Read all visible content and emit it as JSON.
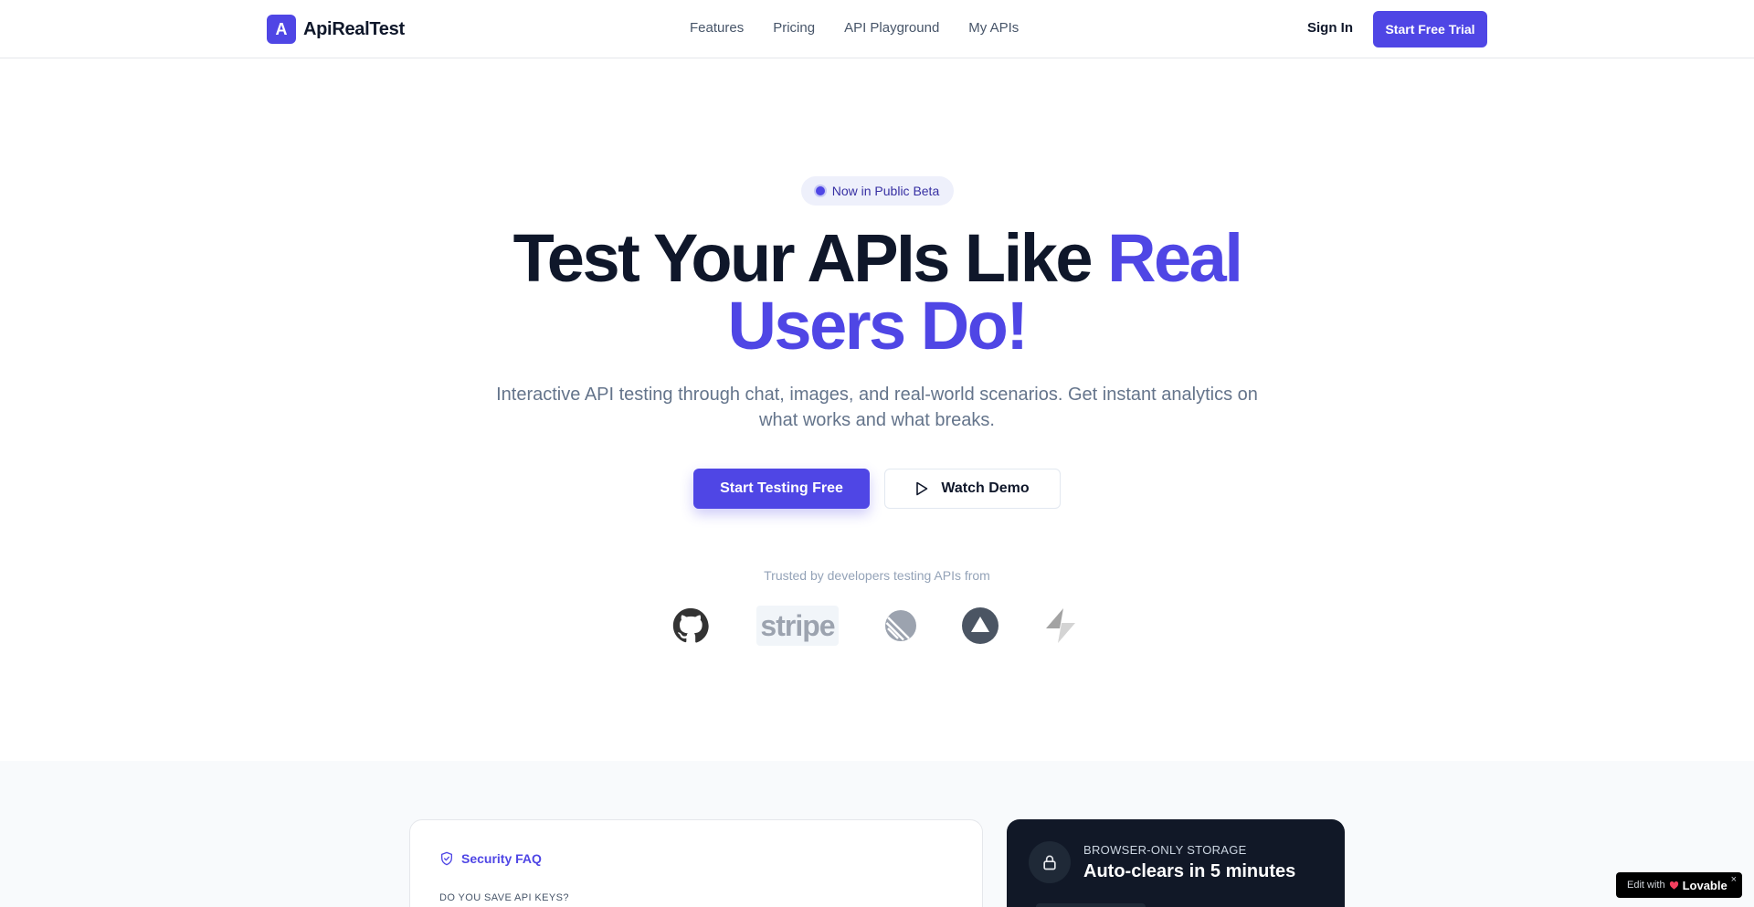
{
  "header": {
    "logo_mark": "A",
    "logo_text": "ApiRealTest",
    "nav": [
      "Features",
      "Pricing",
      "API Playground",
      "My APIs"
    ],
    "sign_in": "Sign In",
    "cta": "Start Free Trial"
  },
  "hero": {
    "badge": "Now in Public Beta",
    "title_plain": "Test Your APIs Like ",
    "title_accent": "Real Users Do!",
    "subtitle": "Interactive API testing through chat, images, and real-world scenarios. Get instant analytics on what works and what breaks.",
    "primary_cta": "Start Testing Free",
    "secondary_cta": "Watch Demo",
    "trusted_text": "Trusted by developers testing APIs from",
    "brand_stripe": "stripe",
    "brand_icons": [
      "github-icon",
      "stripe-logo",
      "linear-icon",
      "vercel-icon",
      "supabase-icon"
    ]
  },
  "security": {
    "faq_title": "Security FAQ",
    "faq_question": "DO YOU SAVE API KEYS?",
    "storage_kicker": "BROWSER-ONLY STORAGE",
    "storage_title": "Auto-clears in 5 minutes"
  },
  "badge": {
    "prefix": "Edit with",
    "brand": "Lovable",
    "close": "×"
  },
  "colors": {
    "accent": "#4f46e5",
    "dark": "#0f172a",
    "muted": "#64748b",
    "card_dark": "#111827"
  }
}
